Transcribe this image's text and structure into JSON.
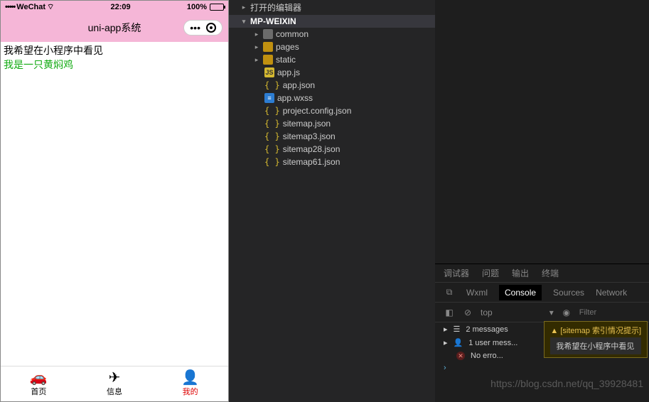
{
  "status": {
    "carrier": "WeChat",
    "signal": "•••••",
    "wifi": "⌔",
    "time": "22:09",
    "battery": "100%"
  },
  "nav": {
    "title": "uni-app系统"
  },
  "page": {
    "line1": "我希望在小程序中看见",
    "line2": "我是一只黄焖鸡"
  },
  "tabs": [
    {
      "icon": "🚗",
      "label": "首页"
    },
    {
      "icon": "✈",
      "label": "信息"
    },
    {
      "icon": "👤",
      "label": "我的",
      "active": true
    }
  ],
  "fileTree": {
    "openEditors": "打开的编辑器",
    "root": "MP-WEIXIN",
    "items": [
      {
        "type": "folder-grey",
        "name": "common"
      },
      {
        "type": "folder-orange",
        "name": "pages"
      },
      {
        "type": "folder-orange",
        "name": "static"
      },
      {
        "type": "js",
        "name": "app.js"
      },
      {
        "type": "json",
        "name": "app.json"
      },
      {
        "type": "wxss",
        "name": "app.wxss"
      },
      {
        "type": "json",
        "name": "project.config.json"
      },
      {
        "type": "json",
        "name": "sitemap.json"
      },
      {
        "type": "json",
        "name": "sitemap3.json"
      },
      {
        "type": "json",
        "name": "sitemap28.json"
      },
      {
        "type": "json",
        "name": "sitemap61.json"
      }
    ]
  },
  "devtools": {
    "primaryTabs": [
      "调试器",
      "问题",
      "输出",
      "终端"
    ],
    "subTabs": [
      "Wxml",
      "Console",
      "Sources",
      "Network"
    ],
    "activeSubTab": "Console",
    "contextLabel": "top",
    "filterPlaceholder": "Filter",
    "messages": {
      "summary": "2 messages",
      "userSummary": "1 user mess...",
      "errorLabel": "No erro..."
    },
    "tooltip": {
      "title": "[sitemap 索引情况提示]",
      "body": "我希望在小程序中看见"
    }
  },
  "watermark": "https://blog.csdn.net/qq_39928481"
}
